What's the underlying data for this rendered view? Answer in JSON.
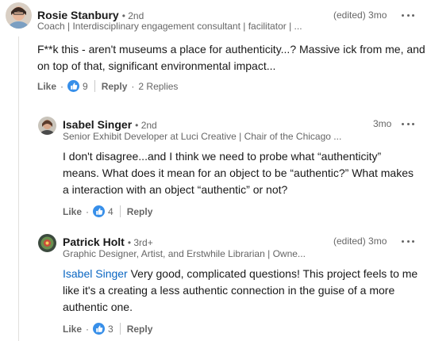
{
  "comments": [
    {
      "author": "Rosie Stanbury",
      "degree": "• 2nd",
      "headline": "Coach | Interdisciplinary engagement consultant | facilitator | ...",
      "meta": "(edited) 3mo",
      "text": "F**k this - aren't museums a place for authenticity...? Massive ick from me, and on top of that, significant environmental impact...",
      "like_label": "Like",
      "like_count": "9",
      "reply_label": "Reply",
      "replies_label": "2 Replies"
    },
    {
      "author": "Isabel Singer",
      "degree": "• 2nd",
      "headline": "Senior Exhibit Developer at Luci Creative | Chair of the Chicago ...",
      "meta": "3mo",
      "text": "I don't disagree...and I think we need to probe what “authenticity” means. What does it mean for an object to be “authentic?” What makes a interaction with an object “authentic” or not?",
      "like_label": "Like",
      "like_count": "4",
      "reply_label": "Reply"
    },
    {
      "author": "Patrick Holt",
      "degree": "• 3rd+",
      "headline": "Graphic Designer, Artist, and Erstwhile Librarian | Owne...",
      "meta": "(edited) 3mo",
      "mention": "Isabel Singer",
      "text": " Very good, complicated questions! This project feels to me like it's a creating a less authentic connection in the guise of a more authentic one.",
      "like_label": "Like",
      "like_count": "3",
      "reply_label": "Reply"
    }
  ],
  "colors": {
    "link": "#0a66c2",
    "like_icon": "#378fe9",
    "muted": "#666666"
  },
  "icons": {
    "like": "thumbs-up-icon",
    "more": "more-options-icon"
  }
}
